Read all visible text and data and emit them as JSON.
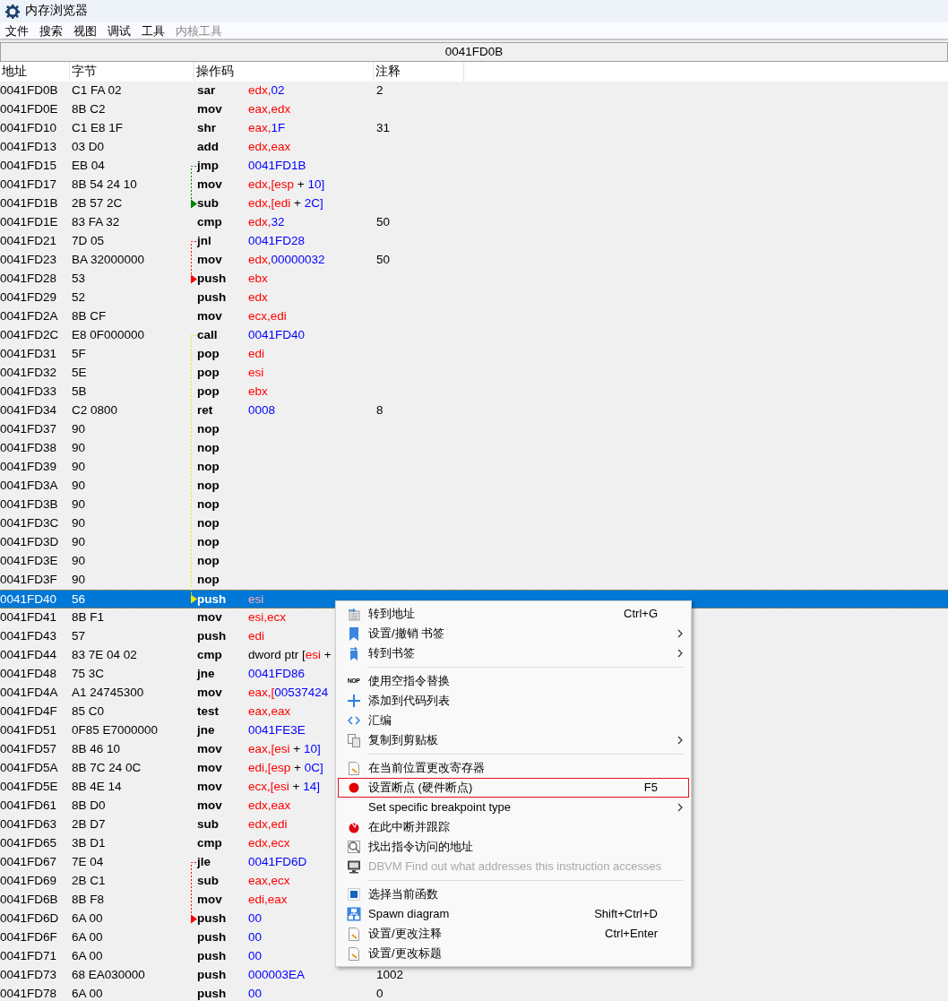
{
  "window": {
    "title": "内存浏览器"
  },
  "menubar": [
    {
      "label": "文件",
      "disabled": false
    },
    {
      "label": "搜索",
      "disabled": false
    },
    {
      "label": "视图",
      "disabled": false
    },
    {
      "label": "调试",
      "disabled": false
    },
    {
      "label": "工具",
      "disabled": false
    },
    {
      "label": "内核工具",
      "disabled": true
    }
  ],
  "address_bar": "0041FD0B",
  "table": {
    "columns": [
      "地址",
      "字节",
      "操作码",
      "注释"
    ],
    "rows": [
      {
        "address": "0041FD0B",
        "bytes": "C1 FA 02",
        "mnemonic": "sar",
        "operand": [
          {
            "kind": "reg",
            "text": "edx,"
          },
          {
            "kind": "num",
            "text": "02"
          }
        ],
        "comment": "2",
        "selected": false
      },
      {
        "address": "0041FD0E",
        "bytes": "8B C2",
        "mnemonic": "mov",
        "operand": [
          {
            "kind": "reg",
            "text": "eax,edx"
          }
        ],
        "selected": false
      },
      {
        "address": "0041FD10",
        "bytes": "C1 E8 1F",
        "mnemonic": "shr",
        "operand": [
          {
            "kind": "reg",
            "text": "eax,"
          },
          {
            "kind": "num",
            "text": "1F"
          }
        ],
        "comment": "31",
        "selected": false
      },
      {
        "address": "0041FD13",
        "bytes": "03 D0",
        "mnemonic": "add",
        "operand": [
          {
            "kind": "reg",
            "text": "edx,eax"
          }
        ],
        "selected": false
      },
      {
        "address": "0041FD15",
        "bytes": "EB 04",
        "mnemonic": "jmp",
        "operand": [
          {
            "kind": "num",
            "text": "0041FD1B"
          }
        ],
        "selected": false,
        "arrow": {
          "kind": "start",
          "color": "#008000"
        }
      },
      {
        "address": "0041FD17",
        "bytes": "8B 54 24 10",
        "mnemonic": "mov",
        "operand": [
          {
            "kind": "reg",
            "text": "edx,[esp"
          },
          {
            "kind": "txt",
            "text": " + "
          },
          {
            "kind": "num",
            "text": "10]"
          }
        ],
        "selected": false
      },
      {
        "address": "0041FD1B",
        "bytes": "2B 57 2C",
        "mnemonic": "sub",
        "operand": [
          {
            "kind": "reg",
            "text": "edx,[edi"
          },
          {
            "kind": "txt",
            "text": " + "
          },
          {
            "kind": "num",
            "text": "2C]"
          }
        ],
        "selected": false,
        "arrow": {
          "kind": "end",
          "color": "#008000"
        }
      },
      {
        "address": "0041FD1E",
        "bytes": "83 FA 32",
        "mnemonic": "cmp",
        "operand": [
          {
            "kind": "reg",
            "text": "edx,"
          },
          {
            "kind": "num",
            "text": "32"
          }
        ],
        "comment": "50",
        "selected": false
      },
      {
        "address": "0041FD21",
        "bytes": "7D 05",
        "mnemonic": "jnl",
        "operand": [
          {
            "kind": "num",
            "text": "0041FD28"
          }
        ],
        "selected": false,
        "arrow": {
          "kind": "start",
          "color": "#ff0000"
        }
      },
      {
        "address": "0041FD23",
        "bytes": "BA 32000000",
        "mnemonic": "mov",
        "operand": [
          {
            "kind": "reg",
            "text": "edx,"
          },
          {
            "kind": "num",
            "text": "00000032"
          }
        ],
        "comment": "50",
        "selected": false
      },
      {
        "address": "0041FD28",
        "bytes": "53",
        "mnemonic": "push",
        "operand": [
          {
            "kind": "reg",
            "text": "ebx"
          }
        ],
        "selected": false,
        "arrow": {
          "kind": "end",
          "color": "#ff0000"
        }
      },
      {
        "address": "0041FD29",
        "bytes": "52",
        "mnemonic": "push",
        "operand": [
          {
            "kind": "reg",
            "text": "edx"
          }
        ],
        "selected": false
      },
      {
        "address": "0041FD2A",
        "bytes": "8B CF",
        "mnemonic": "mov",
        "operand": [
          {
            "kind": "reg",
            "text": "ecx,edi"
          }
        ],
        "selected": false
      },
      {
        "address": "0041FD2C",
        "bytes": "E8 0F000000",
        "mnemonic": "call",
        "operand": [
          {
            "kind": "num",
            "text": "0041FD40"
          }
        ],
        "selected": false,
        "arrow": {
          "kind": "start",
          "color": "#f0e800"
        }
      },
      {
        "address": "0041FD31",
        "bytes": "5F",
        "mnemonic": "pop",
        "operand": [
          {
            "kind": "reg",
            "text": "edi"
          }
        ],
        "selected": false
      },
      {
        "address": "0041FD32",
        "bytes": "5E",
        "mnemonic": "pop",
        "operand": [
          {
            "kind": "reg",
            "text": "esi"
          }
        ],
        "selected": false
      },
      {
        "address": "0041FD33",
        "bytes": "5B",
        "mnemonic": "pop",
        "operand": [
          {
            "kind": "reg",
            "text": "ebx"
          }
        ],
        "selected": false
      },
      {
        "address": "0041FD34",
        "bytes": "C2 0800",
        "mnemonic": "ret",
        "operand": [
          {
            "kind": "num",
            "text": "0008"
          }
        ],
        "comment": "8",
        "selected": false
      },
      {
        "address": "0041FD37",
        "bytes": "90",
        "mnemonic": "nop",
        "selected": false
      },
      {
        "address": "0041FD38",
        "bytes": "90",
        "mnemonic": "nop",
        "selected": false
      },
      {
        "address": "0041FD39",
        "bytes": "90",
        "mnemonic": "nop",
        "selected": false
      },
      {
        "address": "0041FD3A",
        "bytes": "90",
        "mnemonic": "nop",
        "selected": false
      },
      {
        "address": "0041FD3B",
        "bytes": "90",
        "mnemonic": "nop",
        "selected": false
      },
      {
        "address": "0041FD3C",
        "bytes": "90",
        "mnemonic": "nop",
        "selected": false
      },
      {
        "address": "0041FD3D",
        "bytes": "90",
        "mnemonic": "nop",
        "selected": false
      },
      {
        "address": "0041FD3E",
        "bytes": "90",
        "mnemonic": "nop",
        "selected": false
      },
      {
        "address": "0041FD3F",
        "bytes": "90",
        "mnemonic": "nop",
        "selected": false
      },
      {
        "address": "0041FD40",
        "bytes": "56",
        "mnemonic": "push",
        "operand": [
          {
            "kind": "reg",
            "text": "esi"
          }
        ],
        "selected": true,
        "arrow": {
          "kind": "end",
          "color": "#f0e800"
        }
      },
      {
        "address": "0041FD41",
        "bytes": "8B F1",
        "mnemonic": "mov",
        "operand": [
          {
            "kind": "reg",
            "text": "esi,ecx"
          }
        ],
        "selected": false
      },
      {
        "address": "0041FD43",
        "bytes": "57",
        "mnemonic": "push",
        "operand": [
          {
            "kind": "reg",
            "text": "edi"
          }
        ],
        "selected": false
      },
      {
        "address": "0041FD44",
        "bytes": "83 7E 04 02",
        "mnemonic": "cmp",
        "operand": [
          {
            "kind": "txt",
            "text": "dword ptr ["
          },
          {
            "kind": "reg",
            "text": "esi"
          },
          {
            "kind": "txt",
            "text": " +"
          }
        ],
        "selected": false
      },
      {
        "address": "0041FD48",
        "bytes": "75 3C",
        "mnemonic": "jne",
        "operand": [
          {
            "kind": "num",
            "text": "0041FD86"
          }
        ],
        "selected": false
      },
      {
        "address": "0041FD4A",
        "bytes": "A1 24745300",
        "mnemonic": "mov",
        "operand": [
          {
            "kind": "reg",
            "text": "eax,["
          },
          {
            "kind": "num",
            "text": "00537424"
          }
        ],
        "selected": false
      },
      {
        "address": "0041FD4F",
        "bytes": "85 C0",
        "mnemonic": "test",
        "operand": [
          {
            "kind": "reg",
            "text": "eax,eax"
          }
        ],
        "selected": false
      },
      {
        "address": "0041FD51",
        "bytes": "0F85 E7000000",
        "mnemonic": "jne",
        "operand": [
          {
            "kind": "num",
            "text": "0041FE3E"
          }
        ],
        "selected": false
      },
      {
        "address": "0041FD57",
        "bytes": "8B 46 10",
        "mnemonic": "mov",
        "operand": [
          {
            "kind": "reg",
            "text": "eax,[esi"
          },
          {
            "kind": "txt",
            "text": " + "
          },
          {
            "kind": "num",
            "text": "10]"
          }
        ],
        "selected": false
      },
      {
        "address": "0041FD5A",
        "bytes": "8B 7C 24 0C",
        "mnemonic": "mov",
        "operand": [
          {
            "kind": "reg",
            "text": "edi,[esp"
          },
          {
            "kind": "txt",
            "text": " + "
          },
          {
            "kind": "num",
            "text": "0C]"
          }
        ],
        "selected": false
      },
      {
        "address": "0041FD5E",
        "bytes": "8B 4E 14",
        "mnemonic": "mov",
        "operand": [
          {
            "kind": "reg",
            "text": "ecx,[esi"
          },
          {
            "kind": "txt",
            "text": " + "
          },
          {
            "kind": "num",
            "text": "14]"
          }
        ],
        "selected": false
      },
      {
        "address": "0041FD61",
        "bytes": "8B D0",
        "mnemonic": "mov",
        "operand": [
          {
            "kind": "reg",
            "text": "edx,eax"
          }
        ],
        "selected": false
      },
      {
        "address": "0041FD63",
        "bytes": "2B D7",
        "mnemonic": "sub",
        "operand": [
          {
            "kind": "reg",
            "text": "edx,edi"
          }
        ],
        "selected": false
      },
      {
        "address": "0041FD65",
        "bytes": "3B D1",
        "mnemonic": "cmp",
        "operand": [
          {
            "kind": "reg",
            "text": "edx,ecx"
          }
        ],
        "selected": false
      },
      {
        "address": "0041FD67",
        "bytes": "7E 04",
        "mnemonic": "jle",
        "operand": [
          {
            "kind": "num",
            "text": "0041FD6D"
          }
        ],
        "selected": false,
        "arrow": {
          "kind": "start",
          "color": "#ff0000"
        }
      },
      {
        "address": "0041FD69",
        "bytes": "2B C1",
        "mnemonic": "sub",
        "operand": [
          {
            "kind": "reg",
            "text": "eax,ecx"
          }
        ],
        "selected": false
      },
      {
        "address": "0041FD6B",
        "bytes": "8B F8",
        "mnemonic": "mov",
        "operand": [
          {
            "kind": "reg",
            "text": "edi,eax"
          }
        ],
        "selected": false
      },
      {
        "address": "0041FD6D",
        "bytes": "6A 00",
        "mnemonic": "push",
        "operand": [
          {
            "kind": "num",
            "text": "00"
          }
        ],
        "selected": false,
        "arrow": {
          "kind": "end",
          "color": "#ff0000"
        }
      },
      {
        "address": "0041FD6F",
        "bytes": "6A 00",
        "mnemonic": "push",
        "operand": [
          {
            "kind": "num",
            "text": "00"
          }
        ],
        "selected": false
      },
      {
        "address": "0041FD71",
        "bytes": "6A 00",
        "mnemonic": "push",
        "operand": [
          {
            "kind": "num",
            "text": "00"
          }
        ],
        "selected": false
      },
      {
        "address": "0041FD73",
        "bytes": "68 EA030000",
        "mnemonic": "push",
        "operand": [
          {
            "kind": "num",
            "text": "000003EA"
          }
        ],
        "comment": "1002",
        "selected": false
      },
      {
        "address": "0041FD78",
        "bytes": "6A 00",
        "mnemonic": "push",
        "operand": [
          {
            "kind": "num",
            "text": "00"
          }
        ],
        "comment": "0",
        "selected": false
      }
    ]
  },
  "context_menu": [
    {
      "kind": "item",
      "label": "转到地址",
      "shortcut": "Ctrl+G",
      "submenu": false,
      "disabled": false,
      "highlighted": false
    },
    {
      "kind": "item",
      "label": "设置/撤销 书签",
      "submenu": true,
      "disabled": false,
      "highlighted": false
    },
    {
      "kind": "item",
      "label": "转到书签",
      "submenu": true,
      "disabled": false,
      "highlighted": false
    },
    {
      "kind": "separator"
    },
    {
      "kind": "item",
      "icon_text": "NOP",
      "label": "使用空指令替换",
      "submenu": false,
      "disabled": false,
      "highlighted": false
    },
    {
      "kind": "item",
      "label": "添加到代码列表",
      "submenu": false,
      "disabled": false,
      "highlighted": false
    },
    {
      "kind": "item",
      "label": "汇编",
      "submenu": false,
      "disabled": false,
      "highlighted": false
    },
    {
      "kind": "item",
      "label": "复制到剪贴板",
      "submenu": true,
      "disabled": false,
      "highlighted": false
    },
    {
      "kind": "separator"
    },
    {
      "kind": "item",
      "label": "在当前位置更改寄存器",
      "submenu": false,
      "disabled": false,
      "highlighted": false
    },
    {
      "kind": "item",
      "label": "设置断点 (硬件断点)",
      "shortcut": "F5",
      "submenu": false,
      "disabled": false,
      "highlighted": true
    },
    {
      "kind": "item",
      "label": "Set specific breakpoint type",
      "submenu": true,
      "disabled": false,
      "highlighted": false
    },
    {
      "kind": "item",
      "label": "在此中断并跟踪",
      "submenu": false,
      "disabled": false,
      "highlighted": false
    },
    {
      "kind": "item",
      "label": "找出指令访问的地址",
      "submenu": false,
      "disabled": false,
      "highlighted": false
    },
    {
      "kind": "item",
      "label": "DBVM Find out what addresses this instruction accesses",
      "submenu": false,
      "disabled": true,
      "highlighted": false
    },
    {
      "kind": "separator"
    },
    {
      "kind": "item",
      "label": "选择当前函数",
      "submenu": false,
      "disabled": false,
      "highlighted": false
    },
    {
      "kind": "item",
      "label": "Spawn diagram",
      "shortcut": "Shift+Ctrl+D",
      "submenu": false,
      "disabled": false,
      "highlighted": false
    },
    {
      "kind": "item",
      "label": "设置/更改注释",
      "shortcut": "Ctrl+Enter",
      "submenu": false,
      "disabled": false,
      "highlighted": false
    },
    {
      "kind": "item",
      "label": "设置/更改标题",
      "submenu": false,
      "disabled": false,
      "highlighted": false
    }
  ]
}
